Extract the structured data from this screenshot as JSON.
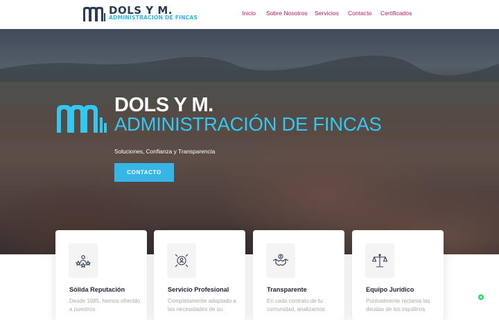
{
  "header": {
    "logo_name": "DOLS Y M.",
    "logo_subtitle": "ADMINISTRACIÓN DE FINCAS",
    "nav": [
      "Inicio",
      "Sobre Nosotros",
      "Servicios",
      "Contacto",
      "Certificados"
    ]
  },
  "hero": {
    "title_line1": "DOLS Y M.",
    "title_line2": "ADMINISTRACIÓN DE FINCAS",
    "tagline": "Soluciones, Confianza y Transparencia",
    "button": "CONTACTO"
  },
  "cards": [
    {
      "title": "Sólida Reputación",
      "text": "Desde 1985, hemos ofrecido a nuestros",
      "icon": "reputation-icon"
    },
    {
      "title": "Servicio Profesional",
      "text": "Completamente adaptado a las necesidades de su",
      "icon": "professional-service-icon"
    },
    {
      "title": "Transparente",
      "text": "En cada contrato de tu comunidad, analizamos",
      "icon": "handshake-icon"
    },
    {
      "title": "Equipo Jurídico",
      "text": "Puntualmente reclama las deudas de los inquilinos",
      "icon": "scales-icon"
    }
  ],
  "colors": {
    "brand_navy": "#2b3a55",
    "brand_cyan": "#35b6e6",
    "nav_link": "#c2185b",
    "chat": "#25d366"
  }
}
